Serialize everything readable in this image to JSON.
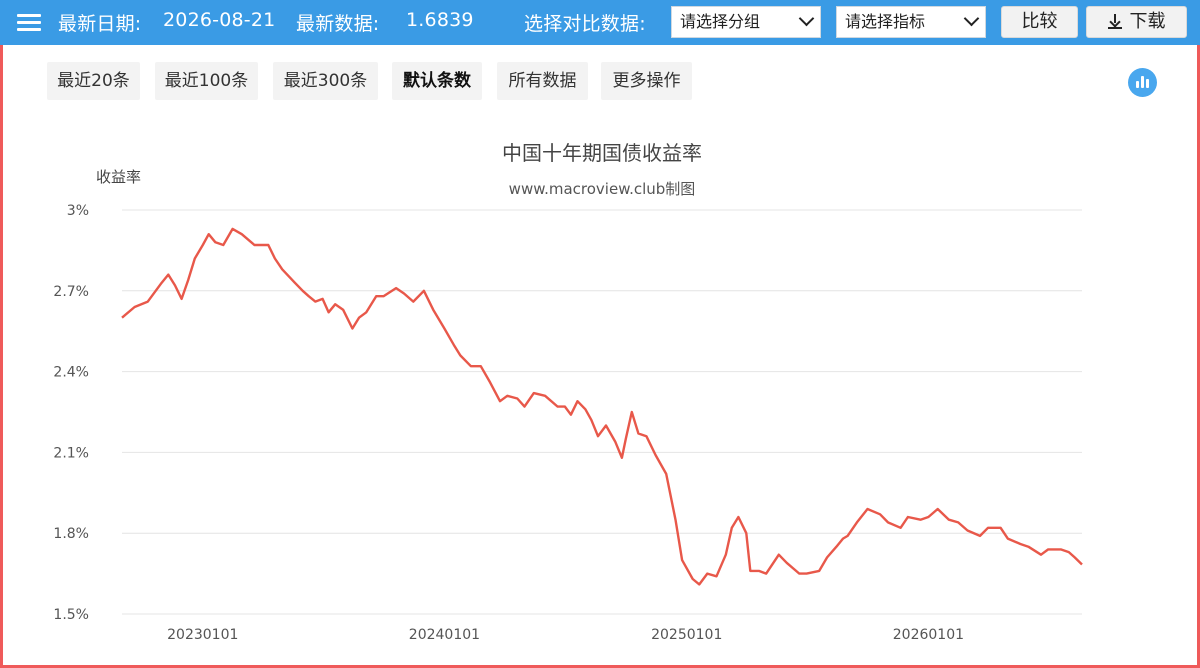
{
  "header": {
    "latest_date_label": "最新日期:",
    "latest_date": "2026-08-21",
    "latest_value_label": "最新数据:",
    "latest_value": "1.6839",
    "compare_label": "选择对比数据:",
    "group_select": "请选择分组",
    "metric_select": "请选择指标",
    "compare_button": "比较",
    "download_button": "下载"
  },
  "filters": [
    "最近20条",
    "最近100条",
    "最近300条",
    "默认条数",
    "所有数据",
    "更多操作"
  ],
  "active_filter": 3,
  "colors": {
    "topbar": "#3a9be5",
    "line": "#e8584a",
    "border": "#ef5a5a"
  },
  "chart_data": {
    "type": "line",
    "title": "中国十年期国债收益率",
    "subtitle": "www.macroview.club制图",
    "ylabel": "收益率",
    "ylim": [
      1.5,
      3.0
    ],
    "yticks": [
      1.5,
      1.8,
      2.1,
      2.4,
      2.7,
      3.0
    ],
    "ytick_labels": [
      "1.5%",
      "1.8%",
      "2.1%",
      "2.4%",
      "2.7%",
      "3%"
    ],
    "xlim": [
      "2022-09-01",
      "2026-08-21"
    ],
    "xtick_dates": [
      "2023-01-01",
      "2024-01-01",
      "2025-01-01",
      "2026-01-01"
    ],
    "xtick_labels": [
      "20230101",
      "20240101",
      "20250101",
      "20260101"
    ],
    "grid": true,
    "series": [
      {
        "x": [
          "2022-09-01",
          "2022-09-20",
          "2022-10-10",
          "2022-10-31",
          "2022-11-10",
          "2022-11-20",
          "2022-11-30",
          "2022-12-10",
          "2022-12-20",
          "2023-01-01",
          "2023-01-10",
          "2023-01-20",
          "2023-02-01",
          "2023-02-15",
          "2023-03-01",
          "2023-03-20",
          "2023-04-10",
          "2023-04-20",
          "2023-05-01",
          "2023-05-20",
          "2023-06-01",
          "2023-06-10",
          "2023-06-20",
          "2023-07-01",
          "2023-07-10",
          "2023-07-20",
          "2023-08-01",
          "2023-08-15",
          "2023-08-25",
          "2023-09-05",
          "2023-09-20",
          "2023-10-01",
          "2023-10-20",
          "2023-11-01",
          "2023-11-15",
          "2023-12-01",
          "2023-12-15",
          "2024-01-01",
          "2024-01-15",
          "2024-01-25",
          "2024-02-10",
          "2024-02-25",
          "2024-03-10",
          "2024-03-25",
          "2024-04-05",
          "2024-04-20",
          "2024-05-01",
          "2024-05-15",
          "2024-06-01",
          "2024-06-20",
          "2024-07-01",
          "2024-07-10",
          "2024-07-20",
          "2024-08-01",
          "2024-08-10",
          "2024-08-20",
          "2024-09-01",
          "2024-09-15",
          "2024-09-25",
          "2024-10-01",
          "2024-10-10",
          "2024-10-20",
          "2024-11-01",
          "2024-11-15",
          "2024-12-01",
          "2024-12-15",
          "2024-12-25",
          "2025-01-10",
          "2025-01-20",
          "2025-02-01",
          "2025-02-15",
          "2025-03-01",
          "2025-03-10",
          "2025-03-20",
          "2025-04-01",
          "2025-04-07",
          "2025-04-20",
          "2025-05-01",
          "2025-05-20",
          "2025-06-01",
          "2025-06-20",
          "2025-07-01",
          "2025-07-20",
          "2025-08-01",
          "2025-08-15",
          "2025-08-25",
          "2025-09-01",
          "2025-09-15",
          "2025-10-01",
          "2025-10-20",
          "2025-11-01",
          "2025-11-20",
          "2025-12-01",
          "2025-12-20",
          "2026-01-01",
          "2026-01-15",
          "2026-02-01",
          "2026-02-15",
          "2026-03-01",
          "2026-03-20",
          "2026-04-01",
          "2026-04-20",
          "2026-05-01",
          "2026-05-20",
          "2026-06-01",
          "2026-06-20",
          "2026-07-01",
          "2026-07-20",
          "2026-08-01",
          "2026-08-10",
          "2026-08-21"
        ],
        "values": [
          2.6,
          2.64,
          2.66,
          2.73,
          2.76,
          2.72,
          2.67,
          2.74,
          2.82,
          2.87,
          2.91,
          2.88,
          2.87,
          2.93,
          2.91,
          2.87,
          2.87,
          2.82,
          2.78,
          2.73,
          2.7,
          2.68,
          2.66,
          2.67,
          2.62,
          2.65,
          2.63,
          2.56,
          2.6,
          2.62,
          2.68,
          2.68,
          2.71,
          2.69,
          2.66,
          2.7,
          2.63,
          2.56,
          2.5,
          2.46,
          2.42,
          2.42,
          2.36,
          2.29,
          2.31,
          2.3,
          2.27,
          2.32,
          2.31,
          2.27,
          2.27,
          2.24,
          2.29,
          2.26,
          2.22,
          2.16,
          2.2,
          2.14,
          2.08,
          2.15,
          2.25,
          2.17,
          2.16,
          2.09,
          2.02,
          1.85,
          1.7,
          1.63,
          1.61,
          1.65,
          1.64,
          1.72,
          1.82,
          1.86,
          1.8,
          1.66,
          1.66,
          1.65,
          1.72,
          1.69,
          1.65,
          1.65,
          1.66,
          1.71,
          1.75,
          1.78,
          1.79,
          1.84,
          1.89,
          1.87,
          1.84,
          1.82,
          1.86,
          1.85,
          1.86,
          1.89,
          1.85,
          1.84,
          1.81,
          1.79,
          1.82,
          1.82,
          1.78,
          1.76,
          1.75,
          1.72,
          1.74,
          1.74,
          1.73,
          1.71,
          1.6839
        ]
      }
    ]
  }
}
